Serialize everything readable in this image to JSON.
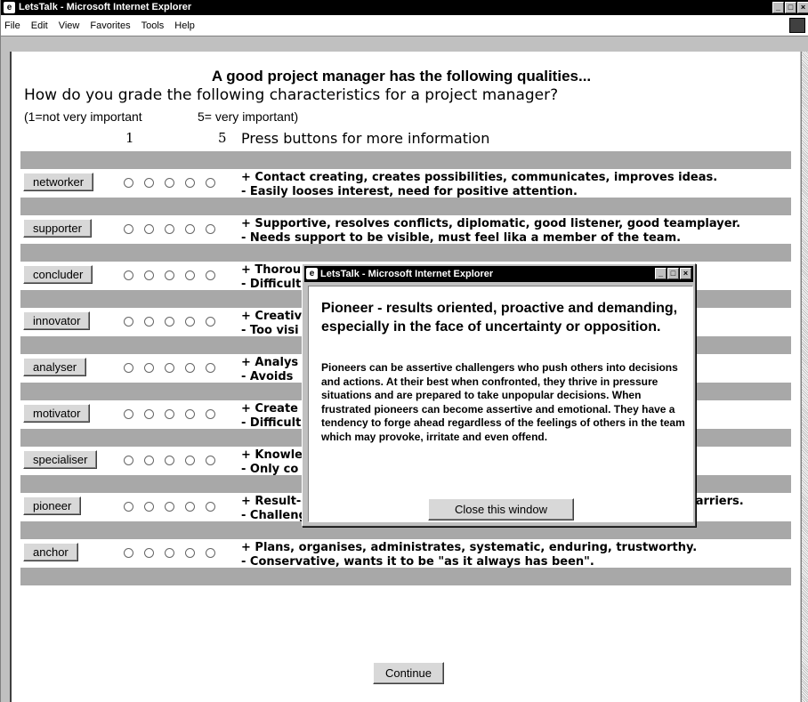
{
  "window": {
    "title": "LetsTalk - Microsoft Internet Explorer",
    "controls": [
      "_",
      "□",
      "×"
    ]
  },
  "menu": [
    "File",
    "Edit",
    "View",
    "Favorites",
    "Tools",
    "Help"
  ],
  "page": {
    "heading": "A good project manager has the following qualities...",
    "question": "How do you grade the following characteristics for a project manager?",
    "scale_low": "(1=not very important",
    "scale_high": "5= very important)",
    "col_low": "1",
    "col_high": "5",
    "info_hint": "Press buttons for more information",
    "continue_label": "Continue"
  },
  "roles": [
    {
      "label": "networker",
      "plus": "+ Contact creating, creates possibilities, communicates, improves ideas.",
      "minus": "- Easily looses interest, need for positive attention."
    },
    {
      "label": "supporter",
      "plus": "+ Supportive, resolves conflicts, diplomatic, good listener, good teamplayer.",
      "minus": "- Needs support to be visible, must feel lika a member of the team."
    },
    {
      "label": "concluder",
      "plus": "+ Thorou",
      "minus": "- Difficult"
    },
    {
      "label": "innovator",
      "plus": "+ Creativ                                                                    problems.",
      "minus": "- Too visi"
    },
    {
      "label": "analyser",
      "plus": "+ Analys",
      "minus": "- Avoids"
    },
    {
      "label": "motivator",
      "plus": "+ Create",
      "minus": "- Difficult"
    },
    {
      "label": "specialiser",
      "plus": "+ Knowle",
      "minus": "- Only co"
    },
    {
      "label": "pioneer",
      "plus": "+ Result-oriented, proactive, demanding, goal-oriented, overcomes barriers.",
      "minus": "- Challenging, impatient, aggressive and provocative."
    },
    {
      "label": "anchor",
      "plus": "+ Plans, organises, administrates, systematic, enduring, trustworthy.",
      "minus": "- Conservative, wants it to be \"as it always has been\"."
    }
  ],
  "popup": {
    "title": "LetsTalk - Microsoft Internet Explorer",
    "heading": "Pioneer - results oriented, proactive and demanding, especially in the face of uncertainty or opposition.",
    "text": "Pioneers can be assertive challengers who push others into decisions and actions. At their best when confronted, they thrive in pressure situations and are prepared to take unpopular decisions. When frustrated pioneers can become assertive and emotional. They have a tendency to forge ahead regardless of the feelings of others in the team which may provoke, irritate and even offend.",
    "close_label": "Close this window"
  }
}
